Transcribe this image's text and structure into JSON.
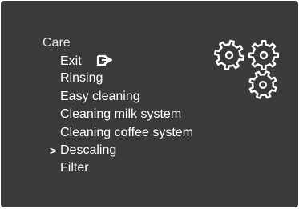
{
  "care_menu": {
    "title": "Care",
    "items": [
      {
        "label": "Exit",
        "icon": "exit-icon",
        "selected": false
      },
      {
        "label": "Rinsing",
        "selected": false
      },
      {
        "label": "Easy cleaning",
        "selected": false
      },
      {
        "label": "Cleaning milk system",
        "selected": false
      },
      {
        "label": "Cleaning coffee system",
        "selected": false
      },
      {
        "label": "Descaling",
        "selected": true
      },
      {
        "label": "Filter",
        "selected": false
      }
    ],
    "selection_marker": ">",
    "decoration_icon": "gears-icon"
  },
  "colors": {
    "screen_background": "#3a3a3a",
    "text": "#ffffff"
  }
}
